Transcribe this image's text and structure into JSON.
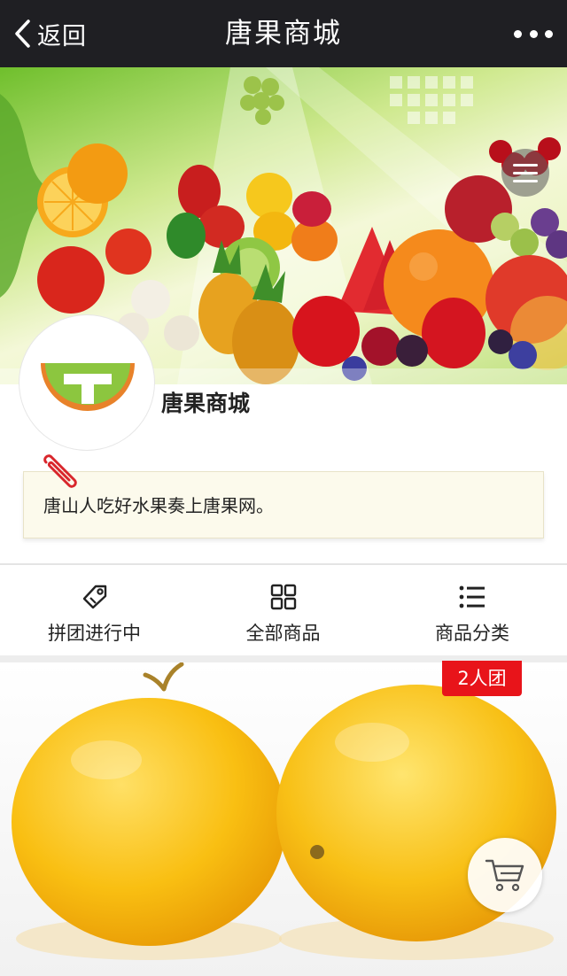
{
  "topbar": {
    "back_label": "返回",
    "title": "唐果商城"
  },
  "shop": {
    "name": "唐果商城",
    "notice": "唐山人吃好水果奏上唐果网。"
  },
  "nav": {
    "items": [
      {
        "label": "拼团进行中",
        "icon": "tag-icon"
      },
      {
        "label": "全部商品",
        "icon": "grid-icon"
      },
      {
        "label": "商品分类",
        "icon": "list-icon"
      }
    ]
  },
  "product": {
    "badge": "2人团"
  },
  "colors": {
    "topbar_bg": "#1f1f23",
    "badge_red": "#e8141a",
    "logo_green": "#8cc63f",
    "logo_orange": "#e8822a"
  }
}
